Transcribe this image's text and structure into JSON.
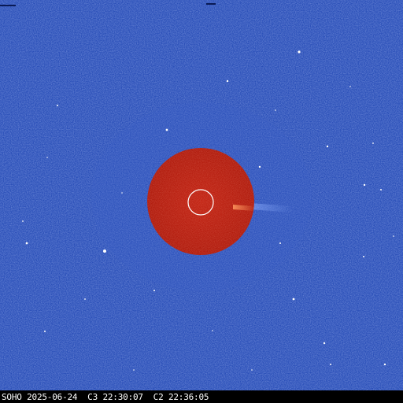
{
  "image": {
    "kind": "coronagraph-image",
    "caption": "SOHO 2025-06-24  C3 22:30:07  C2 22:36:05"
  },
  "colors": {
    "c3_field": "#2a4fb8",
    "c3_field_dark": "#1d3c9e",
    "c2_disk": "#b81f10",
    "c2_disk_dark": "#9c170b",
    "occulter_ring": "#ffffff",
    "caption_bar": "#000000",
    "caption_text": "#ffffff",
    "stars": "#ffffff"
  },
  "icons": {
    "sun_marker": "sun-circle-icon"
  }
}
